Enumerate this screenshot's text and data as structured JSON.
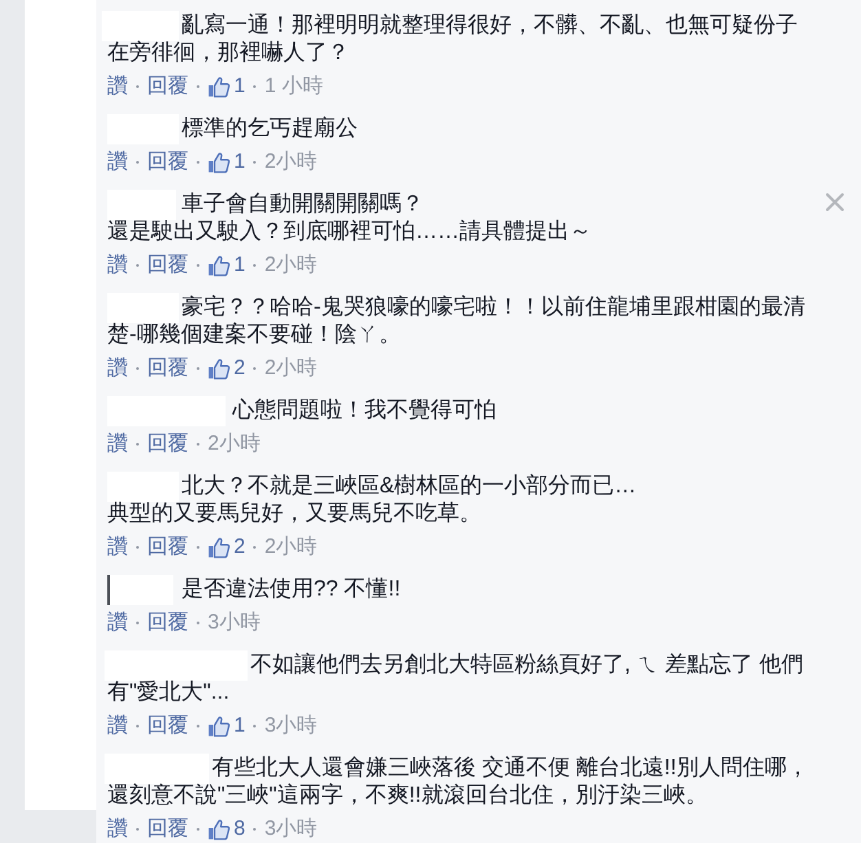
{
  "comments": [
    {
      "lines": [
        "亂寫一通！那裡明明就整理得很好，不髒、不亂、也無可疑份子",
        "在旁徘徊，那裡嚇人了？"
      ],
      "like_label": "讚",
      "reply_label": "回覆",
      "likes": "1",
      "time": "1 小時",
      "hovered": false
    },
    {
      "lines": [
        "標準的乞丐趕廟公"
      ],
      "like_label": "讚",
      "reply_label": "回覆",
      "likes": "1",
      "time": "2小時",
      "hovered": false
    },
    {
      "lines": [
        "車子會自動開關開關嗎？",
        "還是駛出又駛入？到底哪裡可怕……請具體提出～"
      ],
      "like_label": "讚",
      "reply_label": "回覆",
      "likes": "1",
      "time": "2小時",
      "hovered": true
    },
    {
      "lines": [
        "豪宅？？哈哈-鬼哭狼嚎的嚎宅啦！！以前住龍埔里跟柑園的最清",
        "楚-哪幾個建案不要碰！陰ㄚ。"
      ],
      "like_label": "讚",
      "reply_label": "回覆",
      "likes": "2",
      "time": "2小時",
      "hovered": false
    },
    {
      "lines": [
        "心態問題啦！我不覺得可怕"
      ],
      "like_label": "讚",
      "reply_label": "回覆",
      "time": "2小時",
      "hovered": false
    },
    {
      "lines": [
        "北大？不就是三峽區&樹林區的一小部分而已…",
        "典型的又要馬兒好，又要馬兒不吃草。"
      ],
      "like_label": "讚",
      "reply_label": "回覆",
      "likes": "2",
      "time": "2小時",
      "hovered": false
    },
    {
      "lines": [
        "是否違法使用?? 不懂!!"
      ],
      "like_label": "讚",
      "reply_label": "回覆",
      "time": "3小時",
      "hovered": false
    },
    {
      "lines": [
        "不如讓他們去另創北大特區粉絲頁好了, ㄟ 差點忘了 他們",
        "有\"愛北大\"..."
      ],
      "like_label": "讚",
      "reply_label": "回覆",
      "likes": "1",
      "time": "3小時",
      "hovered": false
    },
    {
      "lines": [
        "有些北大人還會嫌三峽落後 交通不便 離台北遠!!別人問住哪，",
        "還刻意不說\"三峽\"這兩字，不爽!!就滾回台北住，別汙染三峽。"
      ],
      "like_label": "讚",
      "reply_label": "回覆",
      "likes": "8",
      "time": "3小時",
      "hovered": false
    }
  ]
}
